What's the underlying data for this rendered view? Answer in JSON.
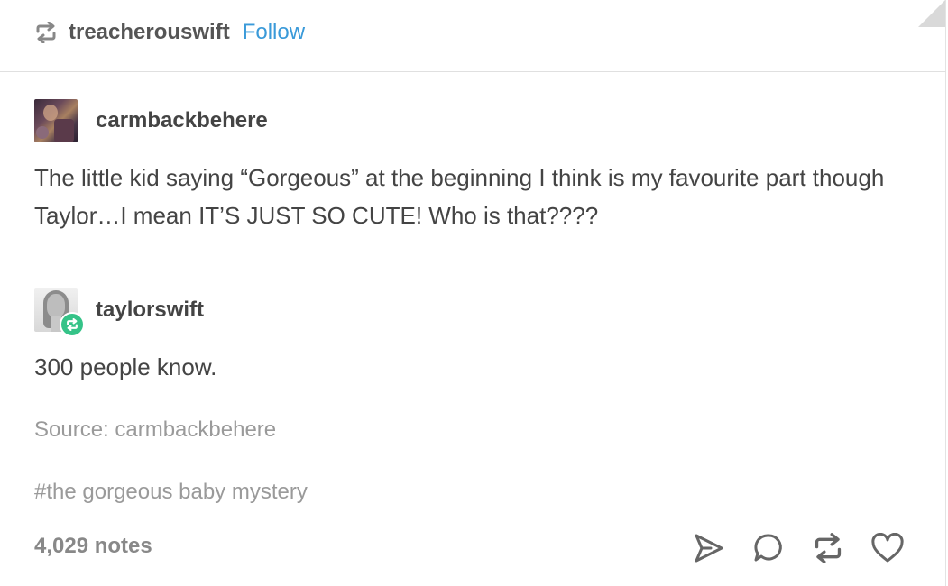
{
  "header": {
    "reblogger": "treacherouswift",
    "follow_label": "Follow"
  },
  "reblog_trail": [
    {
      "username": "carmbackbehere",
      "text": "The little kid saying “Gorgeous” at the beginning I think is my favourite part though Taylor…I mean IT’S JUST SO CUTE! Who is that????"
    },
    {
      "username": "taylorswift",
      "text": "300 people know."
    }
  ],
  "source": "Source: carmbackbehere",
  "tags": "#the gorgeous baby mystery",
  "footer": {
    "notes": "4,029 notes"
  },
  "colors": {
    "accent": "#3a9ad9",
    "reblog_green": "#35c388",
    "text": "#444444",
    "muted": "#9a9a9a"
  },
  "icons": [
    "reblog-icon",
    "share-icon",
    "reply-icon",
    "reblog-icon",
    "heart-icon"
  ]
}
